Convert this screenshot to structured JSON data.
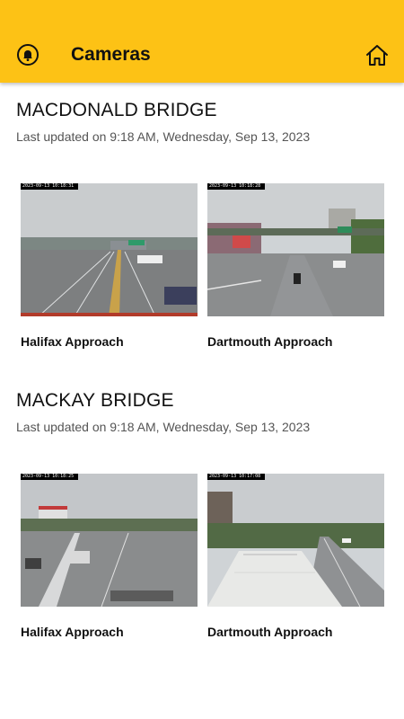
{
  "header": {
    "title": "Cameras",
    "bg_color": "#FDC215",
    "left_icon": "bell-icon",
    "right_icon": "home-icon"
  },
  "sections": [
    {
      "title": "MACDONALD BRIDGE",
      "updated": "Last updated on 9:18 AM, Wednesday, Sep 13, 2023",
      "cameras": [
        {
          "label": "Halifax Approach",
          "timestamp": "2023-09-13 10:18:31"
        },
        {
          "label": "Dartmouth Approach",
          "timestamp": "2023-09-13 10:18:28"
        }
      ]
    },
    {
      "title": "MACKAY BRIDGE",
      "updated": "Last updated on 9:18 AM, Wednesday, Sep 13, 2023",
      "cameras": [
        {
          "label": "Halifax Approach",
          "timestamp": "2023-09-13 10:18:25"
        },
        {
          "label": "Dartmouth Approach",
          "timestamp": "2023-09-13 10:17:08"
        }
      ]
    }
  ]
}
